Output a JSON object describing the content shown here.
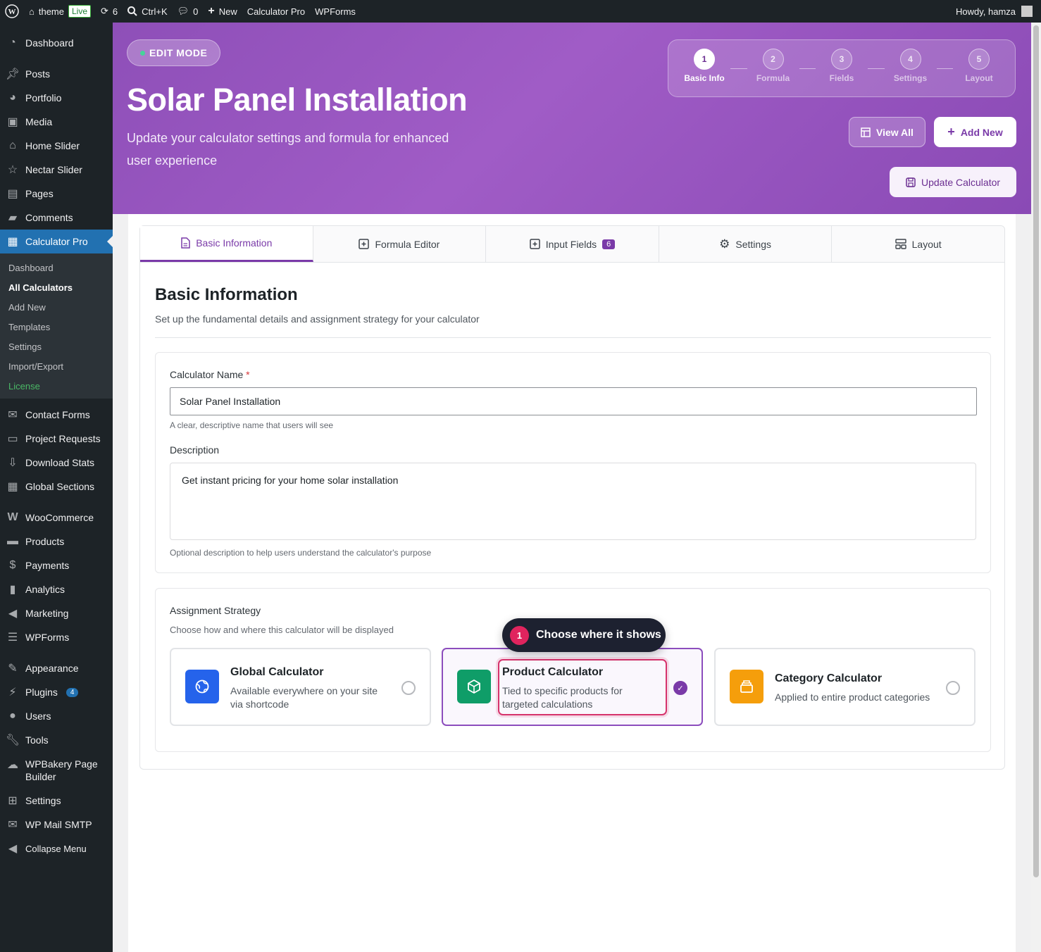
{
  "adminbar": {
    "site": "theme",
    "live": "Live",
    "updates": "6",
    "search": "Ctrl+K",
    "comments": "0",
    "new": "New",
    "calc_pro": "Calculator Pro",
    "wpforms": "WPForms",
    "howdy": "Howdy, hamza"
  },
  "sidebar": {
    "top": [
      {
        "label": "Dashboard",
        "icon": "dashboard-icon"
      }
    ],
    "items1": [
      {
        "label": "Posts",
        "icon": "pin-icon"
      },
      {
        "label": "Portfolio",
        "icon": "portfolio-icon"
      },
      {
        "label": "Media",
        "icon": "media-icon"
      },
      {
        "label": "Home Slider",
        "icon": "home-icon"
      },
      {
        "label": "Nectar Slider",
        "icon": "star-icon"
      },
      {
        "label": "Pages",
        "icon": "pages-icon"
      },
      {
        "label": "Comments",
        "icon": "comment-icon"
      }
    ],
    "active": {
      "label": "Calculator Pro",
      "icon": "calculator-icon"
    },
    "sub": [
      "Dashboard",
      "All Calculators",
      "Add New",
      "Templates",
      "Settings",
      "Import/Export",
      "License"
    ],
    "items2": [
      {
        "label": "Contact Forms",
        "icon": "mail-icon"
      },
      {
        "label": "Project Requests",
        "icon": "folder-icon"
      },
      {
        "label": "Download Stats",
        "icon": "download-icon"
      },
      {
        "label": "Global Sections",
        "icon": "grid-icon"
      }
    ],
    "items3": [
      {
        "label": "WooCommerce",
        "icon": "woo-icon"
      },
      {
        "label": "Products",
        "icon": "archive-icon"
      },
      {
        "label": "Payments",
        "icon": "dollar-icon"
      },
      {
        "label": "Analytics",
        "icon": "chart-icon"
      },
      {
        "label": "Marketing",
        "icon": "megaphone-icon"
      },
      {
        "label": "WPForms",
        "icon": "form-icon"
      }
    ],
    "items4": [
      {
        "label": "Appearance",
        "icon": "brush-icon"
      },
      {
        "label": "Plugins",
        "icon": "plugin-icon",
        "badge": "4"
      },
      {
        "label": "Users",
        "icon": "user-icon"
      },
      {
        "label": "Tools",
        "icon": "wrench-icon"
      },
      {
        "label": "WPBakery Page Builder",
        "icon": "cloud-icon"
      },
      {
        "label": "Settings",
        "icon": "sliders-icon"
      },
      {
        "label": "WP Mail SMTP",
        "icon": "envelope-icon"
      },
      {
        "label": "Collapse Menu",
        "icon": "collapse-icon"
      }
    ]
  },
  "hero": {
    "edit_mode": "EDIT MODE",
    "title": "Solar Panel Installation",
    "subtitle": "Update your calculator settings and formula for enhanced user experience",
    "steps": [
      {
        "num": "1",
        "label": "Basic Info"
      },
      {
        "num": "2",
        "label": "Formula"
      },
      {
        "num": "3",
        "label": "Fields"
      },
      {
        "num": "4",
        "label": "Settings"
      },
      {
        "num": "5",
        "label": "Layout"
      }
    ],
    "view_all": "View All",
    "add_new": "Add New",
    "update": "Update Calculator"
  },
  "tabs": [
    {
      "label": "Basic Information"
    },
    {
      "label": "Formula Editor"
    },
    {
      "label": "Input Fields",
      "badge": "6"
    },
    {
      "label": "Settings"
    },
    {
      "label": "Layout"
    }
  ],
  "basic": {
    "title": "Basic Information",
    "desc": "Set up the fundamental details and assignment strategy for your calculator",
    "name_label": "Calculator Name",
    "name_required": "*",
    "name_value": "Solar Panel Installation",
    "name_help": "A clear, descriptive name that users will see",
    "desc_label": "Description",
    "desc_value": "Get instant pricing for your home solar installation",
    "desc_help": "Optional description to help users understand the calculator's purpose"
  },
  "assignment": {
    "title": "Assignment Strategy",
    "desc": "Choose how and where this calculator will be displayed",
    "options": [
      {
        "title": "Global Calculator",
        "desc": "Available everywhere on your site via shortcode",
        "color": "#2563eb"
      },
      {
        "title": "Product Calculator",
        "desc": "Tied to specific products for targeted calculations",
        "color": "#0f9d68"
      },
      {
        "title": "Category Calculator",
        "desc": "Applied to entire product categories",
        "color": "#f59e0b"
      }
    ]
  },
  "tooltip": {
    "num": "1",
    "text": "Choose where it shows"
  }
}
